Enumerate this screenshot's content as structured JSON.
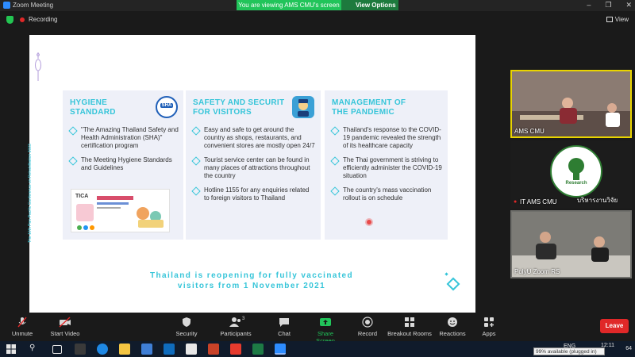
{
  "window": {
    "title": "Zoom Meeting",
    "banner": "You are viewing AMS CMU's screen",
    "view_options": "View Options"
  },
  "recording": {
    "label": "Recording",
    "view_label": "View"
  },
  "slide": {
    "side_text": "The 10th Pan-Pacific Conference on Rehabilitation 2023",
    "panels": [
      {
        "title": "HYGIENE STANDARD",
        "badge": "SHA",
        "bullets": [
          "\"The Amazing Thailand Safety and Health Administration (SHA)\" certification program",
          "The Meeting Hygiene Standards and Guidelines"
        ],
        "poster_brand": "TICA"
      },
      {
        "title": "SAFETY AND SECURIT FOR VISITORS",
        "bullets": [
          "Easy and safe to get around the country as shops, restaurants, and convenient stores are mostly open 24/7",
          "Tourist  service center can be found in many places of attractions throughout the country",
          "Hotline 1155 for any enquiries related to foreign visitors to Thailand"
        ]
      },
      {
        "title": "MANAGEMENT OF THE PANDEMIC",
        "bullets": [
          "Thailand's response to the COVID-19 pandemic revealed the strength of its healthcare capacity",
          "The Thai government is striving to efficiently administer the COVID-19 situation",
          "The country's mass vaccination rollout is on schedule"
        ]
      }
    ],
    "footer": "Thailand is reopening for fully vaccinated visitors from 1 November 2021"
  },
  "participants": [
    {
      "name": "AMS CMU"
    },
    {
      "name": "IT AMS CMU",
      "overlay": "บริหารงานวิจัย",
      "logo_text": "Research"
    },
    {
      "name": "PolyU Zoom RS"
    }
  ],
  "toolbar": {
    "unmute": "Unmute",
    "start_video": "Start Video",
    "security": "Security",
    "participants": "Participants",
    "participants_count": "3",
    "chat": "Chat",
    "share_screen": "Share Screen",
    "record": "Record",
    "breakout_rooms": "Breakout Rooms",
    "reactions": "Reactions",
    "apps": "Apps",
    "leave": "Leave"
  },
  "taskbar": {
    "time": "12:11",
    "lang": "ENG",
    "battery_tooltip": "99% available (plugged in)",
    "notif": "64"
  },
  "colors": {
    "accent": "#36c5d9",
    "share_green": "#21c45a",
    "leave_red": "#e02828"
  }
}
